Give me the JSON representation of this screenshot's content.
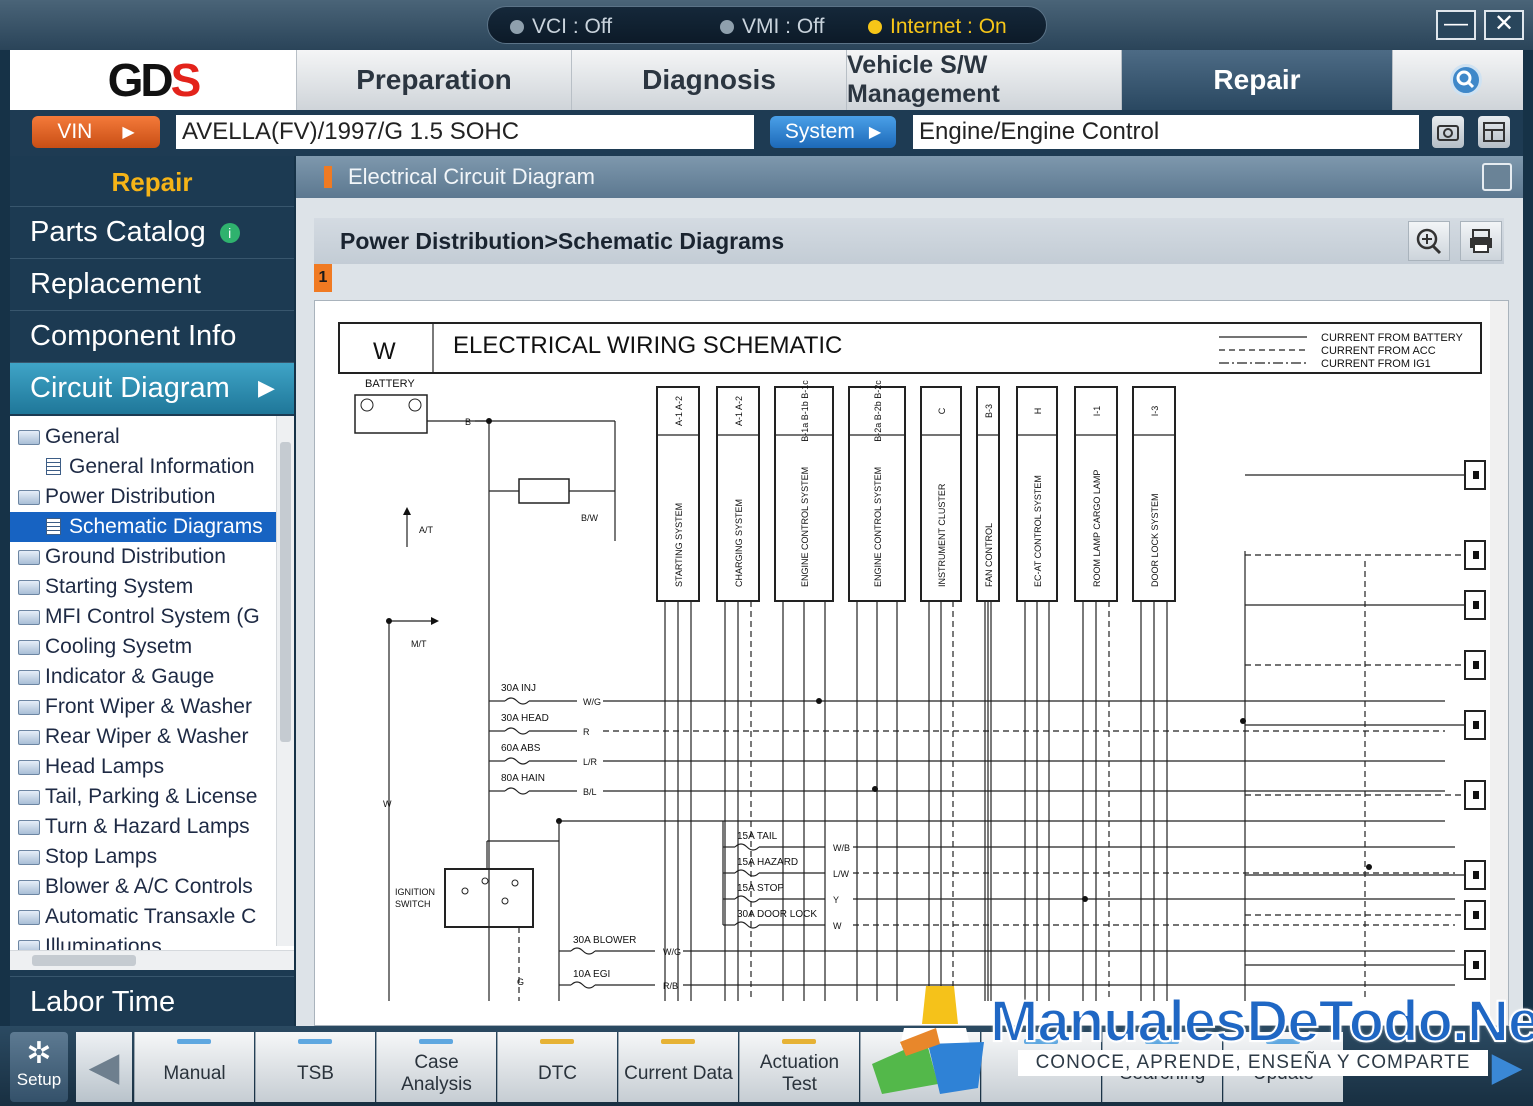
{
  "status": {
    "vci": "VCI : Off",
    "vmi": "VMI : Off",
    "internet": "Internet : On"
  },
  "window": {
    "minimize": "—",
    "close": "✕"
  },
  "logo": {
    "text_a": "GD",
    "text_b": "S"
  },
  "menu": {
    "tabs": [
      "Preparation",
      "Diagnosis",
      "Vehicle S/W Management",
      "Repair"
    ]
  },
  "vin": {
    "vin_label": "VIN",
    "vin_value": "AVELLA(FV)/1997/G 1.5 SOHC",
    "system_label": "System",
    "system_value": "Engine/Engine Control"
  },
  "sidebar": {
    "header": "Repair",
    "nav": [
      "Parts Catalog",
      "Replacement",
      "Component Info",
      "Circuit Diagram"
    ],
    "info_badge": "i",
    "labor": "Labor Time",
    "tree": [
      {
        "label": "General",
        "type": "folder",
        "indent": 0
      },
      {
        "label": "General Information",
        "type": "doc",
        "indent": 1
      },
      {
        "label": "Power Distribution",
        "type": "folder",
        "indent": 0
      },
      {
        "label": "Schematic Diagrams",
        "type": "doc",
        "indent": 1,
        "selected": true
      },
      {
        "label": "Ground Distribution",
        "type": "folder",
        "indent": 0
      },
      {
        "label": "Starting System",
        "type": "folder",
        "indent": 0
      },
      {
        "label": "MFI Control System (G",
        "type": "folder",
        "indent": 0
      },
      {
        "label": "Cooling Sysetm",
        "type": "folder",
        "indent": 0
      },
      {
        "label": "Indicator & Gauge",
        "type": "folder",
        "indent": 0
      },
      {
        "label": "Front Wiper & Washer",
        "type": "folder",
        "indent": 0
      },
      {
        "label": "Rear Wiper & Washer",
        "type": "folder",
        "indent": 0
      },
      {
        "label": "Head Lamps",
        "type": "folder",
        "indent": 0
      },
      {
        "label": "Tail, Parking & License",
        "type": "folder",
        "indent": 0
      },
      {
        "label": "Turn & Hazard Lamps",
        "type": "folder",
        "indent": 0
      },
      {
        "label": "Stop Lamps",
        "type": "folder",
        "indent": 0
      },
      {
        "label": "Blower & A/C Controls",
        "type": "folder",
        "indent": 0
      },
      {
        "label": "Automatic Transaxle C",
        "type": "folder",
        "indent": 0
      },
      {
        "label": "Illuminations",
        "type": "folder",
        "indent": 0
      }
    ]
  },
  "content": {
    "title": "Electrical Circuit Diagram",
    "breadcrumb": "Power Distribution>Schematic Diagrams",
    "page_number": "1"
  },
  "diagram": {
    "section": "W",
    "title": "ELECTRICAL WIRING SCHEMATIC",
    "legend": [
      "CURRENT FROM BATTERY",
      "CURRENT FROM ACC",
      "CURRENT FROM IG1"
    ],
    "battery": "BATTERY",
    "labels": {
      "b": "B",
      "bw": "B/W",
      "at": "A/T",
      "mt": "M/T",
      "w": "W",
      "g": "G",
      "ign1": "IGNITION",
      "ign2": "SWITCH"
    },
    "systems": [
      {
        "code": "A-1 A-2",
        "name": "STARTING SYSTEM"
      },
      {
        "code": "A-1 A-2",
        "name": "CHARGING SYSTEM"
      },
      {
        "code": "B-1a B-1b B-1c",
        "name": "ENGINE CONTROL SYSTEM"
      },
      {
        "code": "B-2a B-2b B-2c",
        "name": "ENGINE CONTROL SYSTEM"
      },
      {
        "code": "C",
        "name": "INSTRUMENT CLUSTER"
      },
      {
        "code": "B-3",
        "name": "FAN CONTROL"
      },
      {
        "code": "H",
        "name": "EC-AT CONTROL SYSTEM"
      },
      {
        "code": "I-1",
        "name": "ROOM LAMP CARGO LAMP"
      },
      {
        "code": "I-3",
        "name": "DOOR LOCK SYSTEM"
      }
    ],
    "fuses_left": [
      {
        "name": "30A INJ",
        "wire": "W/G"
      },
      {
        "name": "30A HEAD",
        "wire": "R"
      },
      {
        "name": "60A ABS",
        "wire": "L/R"
      },
      {
        "name": "80A HAIN",
        "wire": "B/L"
      }
    ],
    "fuses_mid": [
      {
        "name": "15A TAIL",
        "wire": "W/B"
      },
      {
        "name": "15A HAZARD",
        "wire": "L/W"
      },
      {
        "name": "15A STOP",
        "wire": "Y"
      },
      {
        "name": "30A DOOR LOCK",
        "wire": "W"
      }
    ],
    "fuses_bottom": [
      {
        "name": "30A BLOWER",
        "wire": "W/G"
      },
      {
        "name": "10A EGI",
        "wire": "R/B"
      }
    ]
  },
  "toolbar": {
    "setup": "Setup",
    "buttons": [
      {
        "label": "Manual",
        "led": "#5ea7e0"
      },
      {
        "label": "TSB",
        "led": "#5ea7e0"
      },
      {
        "label": "Case Analysis",
        "led": "#5ea7e0"
      },
      {
        "label": "DTC",
        "led": "#e6b235"
      },
      {
        "label": "Current Data",
        "led": "#e6b235"
      },
      {
        "label": "Actuation Test",
        "led": "#e6b235"
      },
      {
        "label": "",
        "led": "#e6b235"
      },
      {
        "label": "",
        "led": "#5ea7e0"
      },
      {
        "label": "Searching",
        "led": "#5ea7e0"
      },
      {
        "label": "Update",
        "led": "#5ea7e0"
      }
    ]
  },
  "watermark": {
    "title": "ManualesDeTodo.Net",
    "subtitle": "CONOCE, APRENDE, ENSEÑA Y COMPARTE"
  }
}
